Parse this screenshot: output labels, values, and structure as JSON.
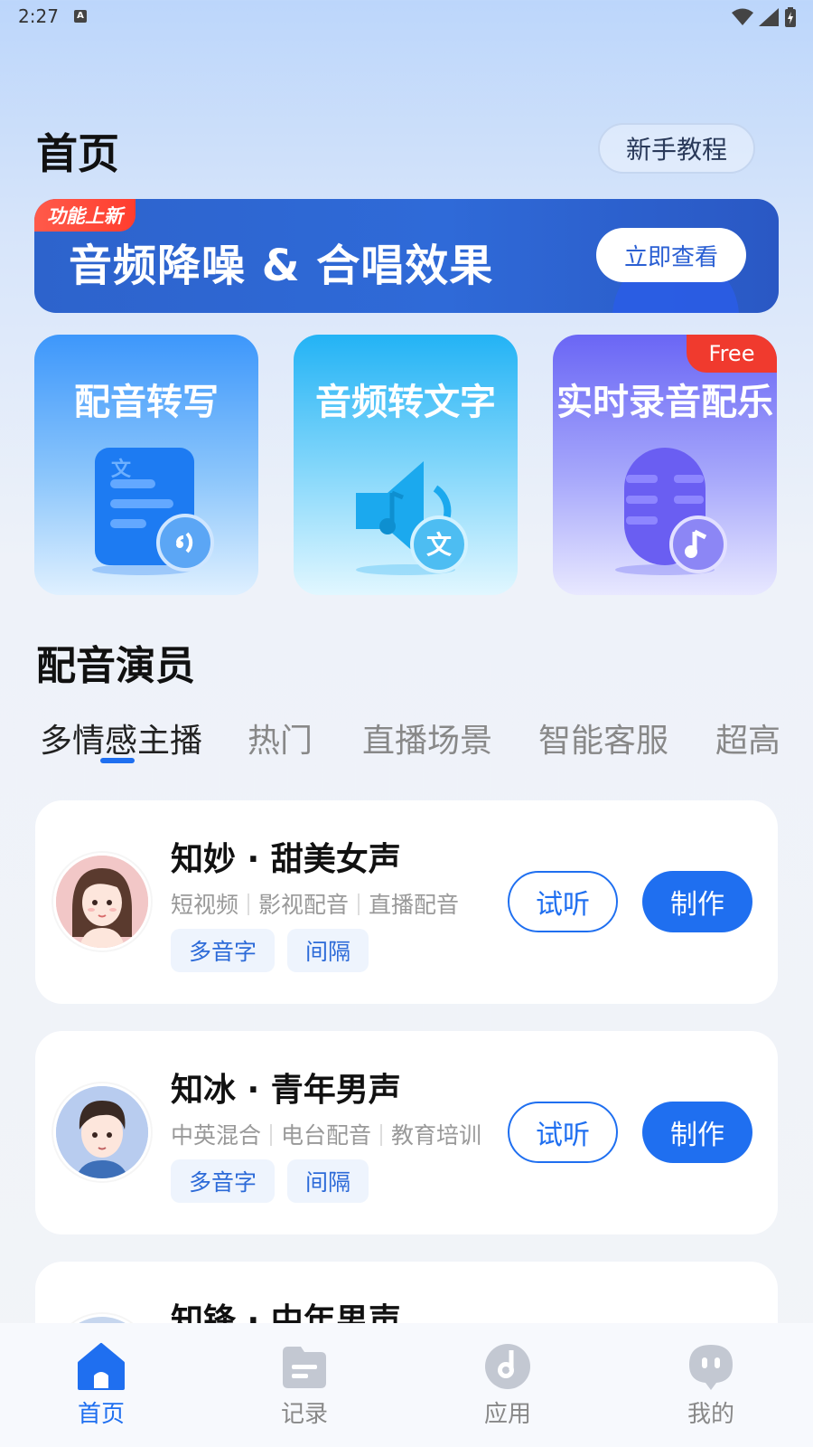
{
  "status_bar": {
    "time": "2:27",
    "notification_letter": "A"
  },
  "header": {
    "title": "首页",
    "tutorial_label": "新手教程"
  },
  "banner": {
    "tag": "功能上新",
    "text": "音频降噪 & 合唱效果",
    "button_label": "立即查看"
  },
  "features": [
    {
      "title": "配音转写"
    },
    {
      "title": "音频转文字"
    },
    {
      "title": "实时录音配乐",
      "badge": "Free"
    }
  ],
  "section": {
    "title": "配音演员"
  },
  "tabs": [
    {
      "label": "多情感主播",
      "active": true
    },
    {
      "label": "热门"
    },
    {
      "label": "直播场景"
    },
    {
      "label": "智能客服"
    },
    {
      "label": "超高"
    }
  ],
  "voices": [
    {
      "name": "知妙 · 甜美女声",
      "scenes": [
        "短视频",
        "影视配音",
        "直播配音"
      ],
      "tags": [
        "多音字",
        "间隔"
      ],
      "listen_label": "试听",
      "make_label": "制作"
    },
    {
      "name": "知冰 · 青年男声",
      "scenes": [
        "中英混合",
        "电台配音",
        "教育培训"
      ],
      "tags": [
        "多音字",
        "间隔"
      ],
      "listen_label": "试听",
      "make_label": "制作"
    },
    {
      "name": "知锋 · 中年男声"
    }
  ],
  "bottom_nav": [
    {
      "label": "首页",
      "icon": "home-icon",
      "active": true
    },
    {
      "label": "记录",
      "icon": "folder-icon"
    },
    {
      "label": "应用",
      "icon": "music-disc-icon"
    },
    {
      "label": "我的",
      "icon": "profile-bubble-icon"
    }
  ],
  "colors": {
    "accent": "#1f6ff0",
    "banner": "#2d63cc",
    "free_badge": "#f03a2e"
  }
}
